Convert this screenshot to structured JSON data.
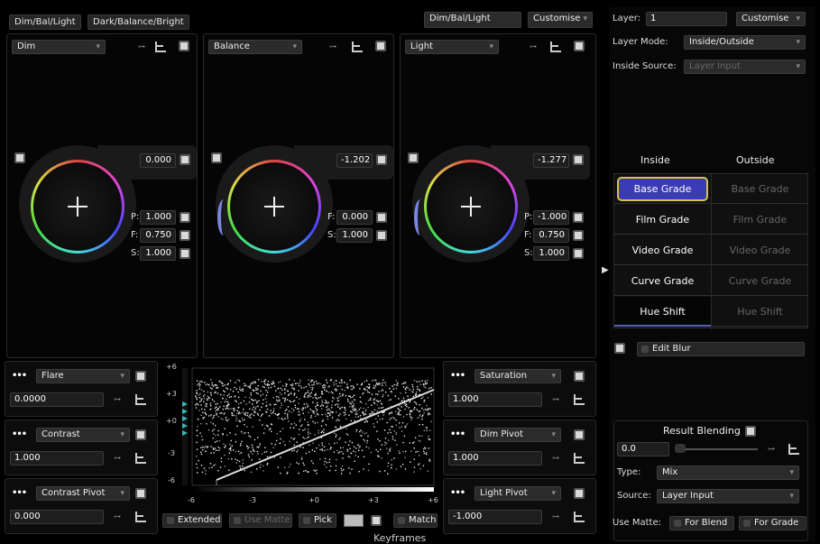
{
  "top_tabs": [
    "Dim/Bal/Light",
    "Dark/Balance/Bright"
  ],
  "preset": {
    "value": "Dim/Bal/Light",
    "customise": "Customise"
  },
  "wheels": [
    {
      "name": "Dim",
      "master": "0.000",
      "rows": [
        {
          "label": "P:",
          "value": "1.000"
        },
        {
          "label": "F:",
          "value": "0.750"
        },
        {
          "label": "S:",
          "value": "1.000"
        }
      ]
    },
    {
      "name": "Balance",
      "master": "-1.202",
      "rows": [
        {
          "label": "F:",
          "value": "0.000"
        },
        {
          "label": "S:",
          "value": "1.000"
        }
      ]
    },
    {
      "name": "Light",
      "master": "-1.277",
      "rows": [
        {
          "label": "P:",
          "value": "-1.000"
        },
        {
          "label": "F:",
          "value": "0.750"
        },
        {
          "label": "S:",
          "value": "1.000"
        }
      ]
    }
  ],
  "left_controls": [
    {
      "name": "Flare",
      "value": "0.0000"
    },
    {
      "name": "Contrast",
      "value": "1.000"
    },
    {
      "name": "Contrast Pivot",
      "value": "0.000"
    }
  ],
  "right_controls": [
    {
      "name": "Saturation",
      "value": "1.000"
    },
    {
      "name": "Dim Pivot",
      "value": "1.000"
    },
    {
      "name": "Light Pivot",
      "value": "-1.000"
    }
  ],
  "dots": "•••",
  "scope": {
    "y_ticks": [
      "+6",
      "+3",
      "+0",
      "-3",
      "-6"
    ],
    "x_ticks": [
      "-6",
      "-3",
      "+0",
      "+3",
      "+6"
    ]
  },
  "bottom_buttons": {
    "extended": "Extended",
    "use_matte": "Use Matte",
    "pick": "Pick",
    "match": "Match"
  },
  "keyframes": "Keyframes",
  "right_panel": {
    "layer_label": "Layer:",
    "layer_value": "1",
    "customise": "Customise",
    "layer_mode_label": "Layer Mode:",
    "layer_mode_value": "Inside/Outside",
    "inside_source_label": "Inside Source:",
    "inside_source_value": "Layer Input",
    "inside_header": "Inside",
    "outside_header": "Outside",
    "inside_items": [
      "Base Grade",
      "Film Grade",
      "Video Grade",
      "Curve Grade",
      "Hue Shift"
    ],
    "outside_items": [
      "Base Grade",
      "Film Grade",
      "Video Grade",
      "Curve Grade",
      "Hue Shift"
    ],
    "edit_blur": "Edit Blur",
    "result_blending": "Result Blending",
    "blend_value": "0.0",
    "type_label": "Type:",
    "type_value": "Mix",
    "source_label": "Source:",
    "source_value": "Layer Input",
    "use_matte_label": "Use Matte:",
    "for_blend": "For Blend",
    "for_grade": "For Grade"
  },
  "colors": {
    "accent_selected": "#d4c440",
    "selected_bg": "#3b3bb5",
    "wheel_arc": "#7b86e0"
  }
}
